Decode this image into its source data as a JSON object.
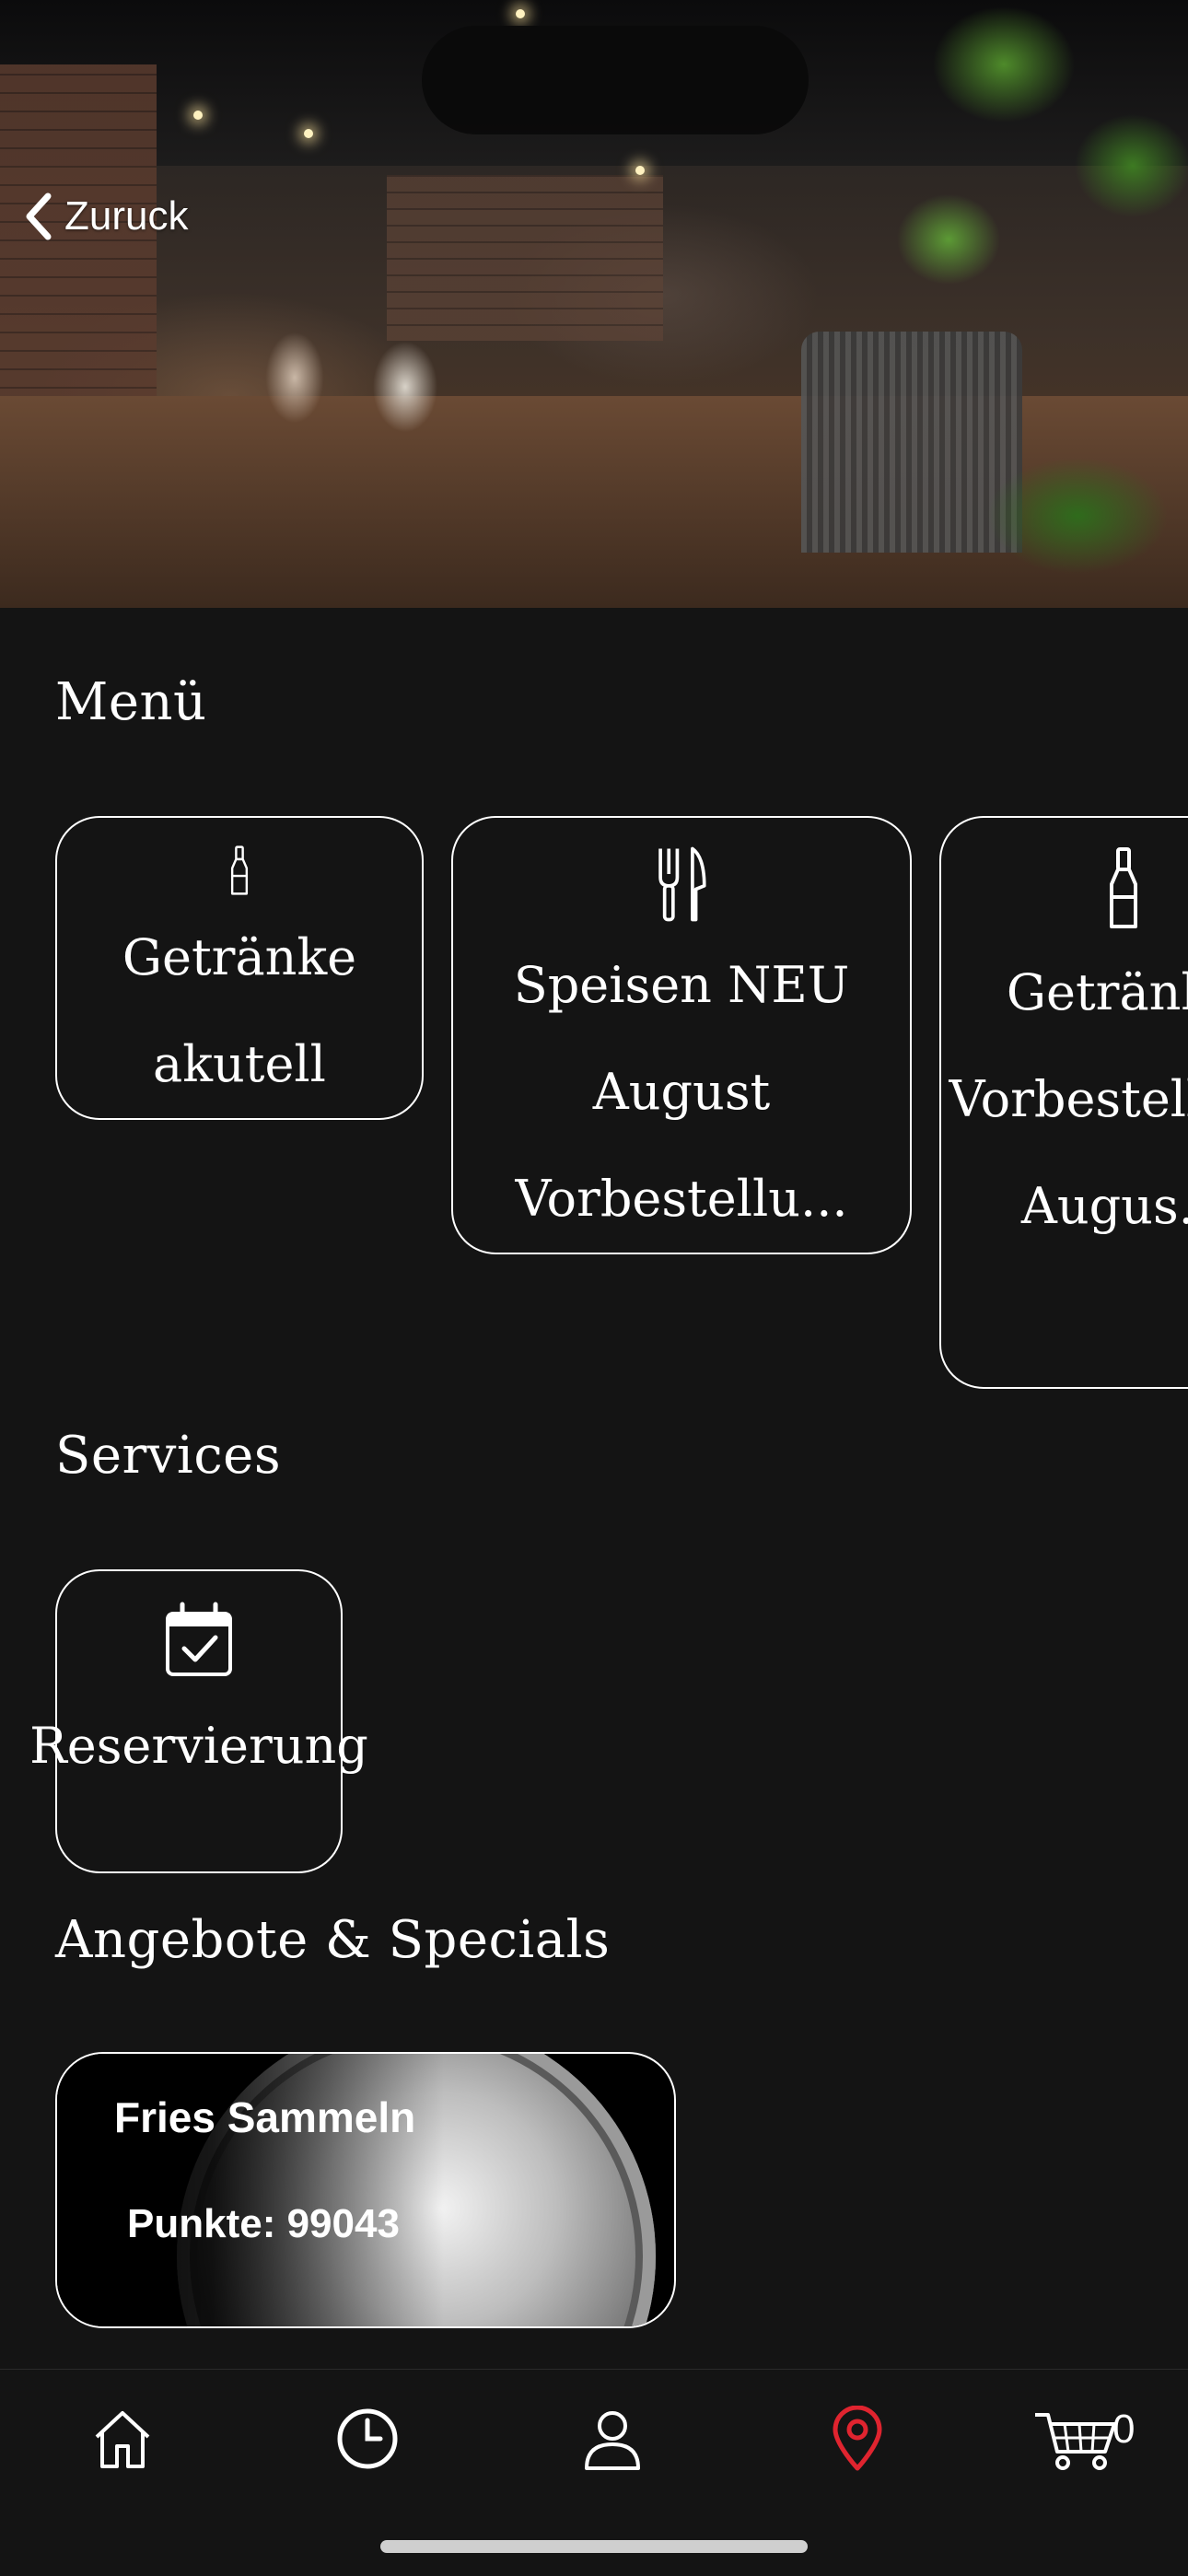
{
  "header": {
    "back_label": "Zuruck"
  },
  "sections": {
    "menu_title": "Menü",
    "services_title": "Services",
    "offers_title": "Angebote & Specials"
  },
  "menu_cards": [
    {
      "label": "Getränke akutell",
      "icon": "bottle-icon"
    },
    {
      "label": "Speisen NEU August Vorbestellu...",
      "icon": "fork-knife-icon"
    },
    {
      "label": "Getränke Vorbestellung Augus...",
      "icon": "bottle-icon"
    }
  ],
  "service_cards": [
    {
      "label": "Reservierung",
      "icon": "calendar-check-icon"
    }
  ],
  "offer": {
    "title": "Fries Sammeln",
    "points_text": "Punkte: 99043"
  },
  "tabbar": {
    "items": [
      "home-icon",
      "clock-icon",
      "user-icon",
      "location-pin-icon",
      "cart-icon"
    ],
    "active": "location-pin-icon",
    "active_color": "#e0242f",
    "cart_count": "0"
  }
}
